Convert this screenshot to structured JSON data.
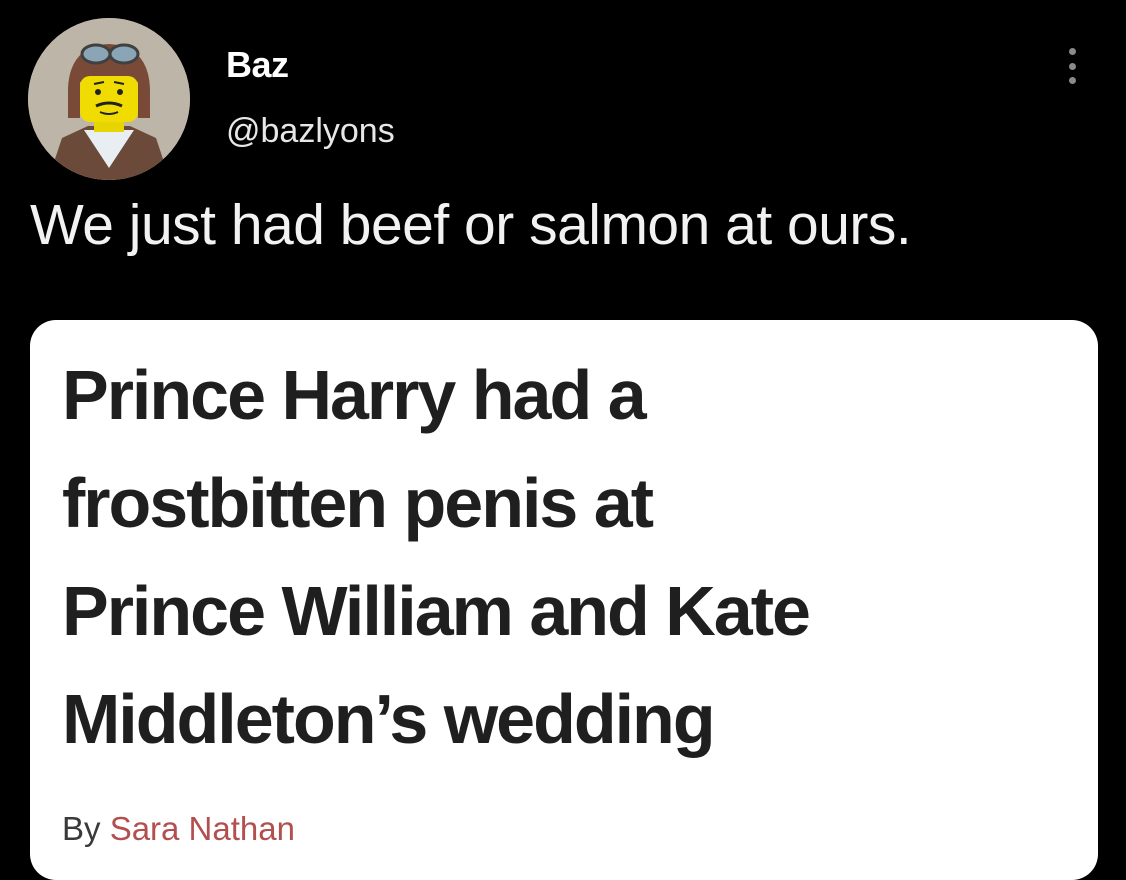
{
  "tweet": {
    "display_name": "Baz",
    "handle": "@bazlyons",
    "text": "We just had beef or salmon at ours.",
    "avatar_icon": "lego-aviator-avatar",
    "more_icon": "vertical-dots-icon"
  },
  "article": {
    "headline_lines": [
      "Prince Harry had a",
      "frostbitten penis at",
      "Prince William and Kate",
      "Middleton’s wedding"
    ],
    "byline_prefix": "By",
    "author": "Sara Nathan"
  },
  "colors": {
    "background": "#000000",
    "card": "#ffffff",
    "headline": "#1f1f1f",
    "author_link": "#b25050"
  }
}
